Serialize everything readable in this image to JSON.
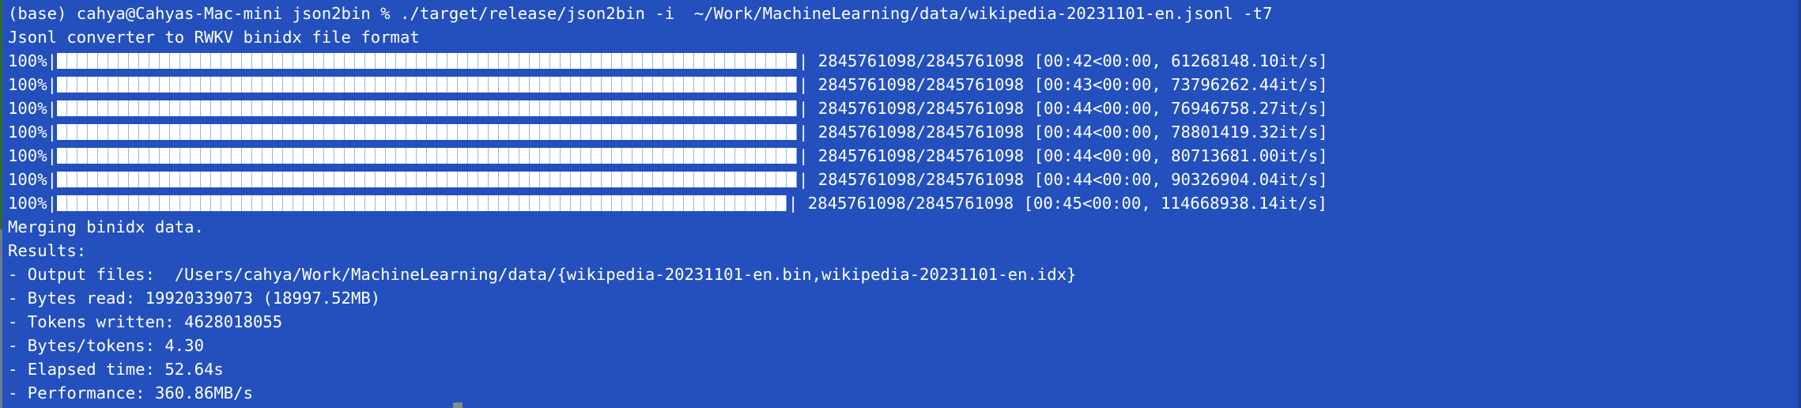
{
  "terminal": {
    "background": "#2350bd",
    "prompt_line": "(base) cahya@Cahyas-Mac-mini json2bin % ./target/release/json2bin -i  ~/Work/MachineLearning/data/wikipedia-20231101-en.jsonl -t7",
    "header_line": "Jsonl converter to RWKV binidx file format",
    "progress_bars": [
      {
        "percent_label": "100%|",
        "progress": 1.0,
        "stats": "| 2845761098/2845761098 [00:42<00:00, 61268148.10it/s]"
      },
      {
        "percent_label": "100%|",
        "progress": 1.0,
        "stats": "| 2845761098/2845761098 [00:43<00:00, 73796262.44it/s]"
      },
      {
        "percent_label": "100%|",
        "progress": 1.0,
        "stats": "| 2845761098/2845761098 [00:44<00:00, 76946758.27it/s]"
      },
      {
        "percent_label": "100%|",
        "progress": 1.0,
        "stats": "| 2845761098/2845761098 [00:44<00:00, 78801419.32it/s]"
      },
      {
        "percent_label": "100%|",
        "progress": 1.0,
        "stats": "| 2845761098/2845761098 [00:44<00:00, 80713681.00it/s]"
      },
      {
        "percent_label": "100%|",
        "progress": 1.0,
        "stats": "| 2845761098/2845761098 [00:44<00:00, 90326904.04it/s]"
      },
      {
        "percent_label": "100%|",
        "progress": 1.0,
        "stats": "| 2845761098/2845761098 [00:45<00:00, 114668938.14it/s]"
      }
    ],
    "merge_line": "Merging binidx data.",
    "results_label": "Results:",
    "results": [
      "- Output files:  /Users/cahya/Work/MachineLearning/data/{wikipedia-20231101-en.bin,wikipedia-20231101-en.idx}",
      "- Bytes read: 19920339073 (18997.52MB)",
      "- Tokens written: 4628018055",
      "- Bytes/tokens: 4.30",
      "- Elapsed time: 52.64s",
      "- Performance: 360.86MB/s"
    ]
  }
}
